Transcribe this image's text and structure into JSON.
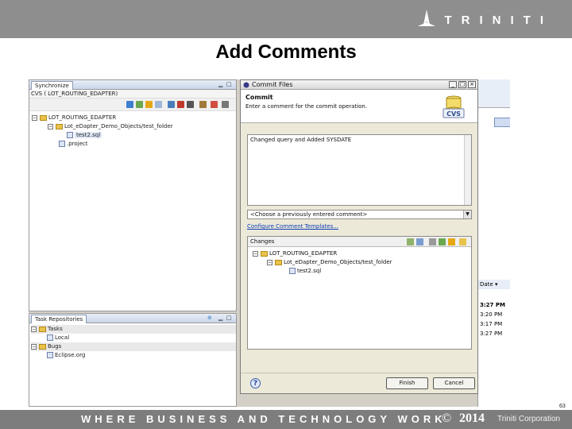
{
  "logo": {
    "text": "TRINITI"
  },
  "slide": {
    "title": "Add Comments",
    "page_number": "63"
  },
  "footer": {
    "tagline": "WHERE BUSINESS AND TECHNOLOGY WORK",
    "copyright_symbol": "©",
    "year": "2014",
    "company": "Triniti Corporation"
  },
  "sync_view": {
    "tab_label": "Synchronize",
    "breadcrumb": "CVS ( LOT_ROUTING_EDAPTER)",
    "tree": [
      {
        "label": "LOT_ROUTING_EDAPTER",
        "kind": "folder",
        "depth": 0
      },
      {
        "label": "Lot_eDapter_Demo_Objects/test_folder",
        "kind": "folder",
        "depth": 1
      },
      {
        "label": "test2.sql",
        "kind": "file",
        "depth": 2
      },
      {
        "label": ".project",
        "kind": "file",
        "depth": 1
      }
    ]
  },
  "task_view": {
    "tab_label": "Task Repositories",
    "tree": [
      {
        "label": "Tasks",
        "kind": "folder",
        "depth": 0
      },
      {
        "label": "Local",
        "kind": "item",
        "depth": 1
      },
      {
        "label": "Bugs",
        "kind": "folder",
        "depth": 0
      },
      {
        "label": "Eclipse.org",
        "kind": "item",
        "depth": 1
      }
    ]
  },
  "right_strip": {
    "times": [
      "3:27 PM",
      "3:20 PM",
      "3:17 PM",
      "3:27 PM"
    ],
    "menu_label": "Date"
  },
  "dialog": {
    "title": "Commit Files",
    "heading": "Commit",
    "instruction": "Enter a comment for the commit operation.",
    "cvs_badge": "CVS",
    "comment_text": "Changed query and Added SYSDATE",
    "previous_placeholder": "<Choose a previously entered comment>",
    "templates_link": "Configure Comment Templates...",
    "changes_label": "Changes",
    "changes_tree": [
      {
        "label": "LOT_ROUTING_EDAPTER",
        "depth": 0,
        "kind": "folder"
      },
      {
        "label": "Lot_eDapter_Demo_Objects/test_folder",
        "depth": 1,
        "kind": "folder"
      },
      {
        "label": "test2.sql",
        "depth": 2,
        "kind": "file"
      }
    ],
    "finish_label": "Finish",
    "cancel_label": "Cancel"
  }
}
